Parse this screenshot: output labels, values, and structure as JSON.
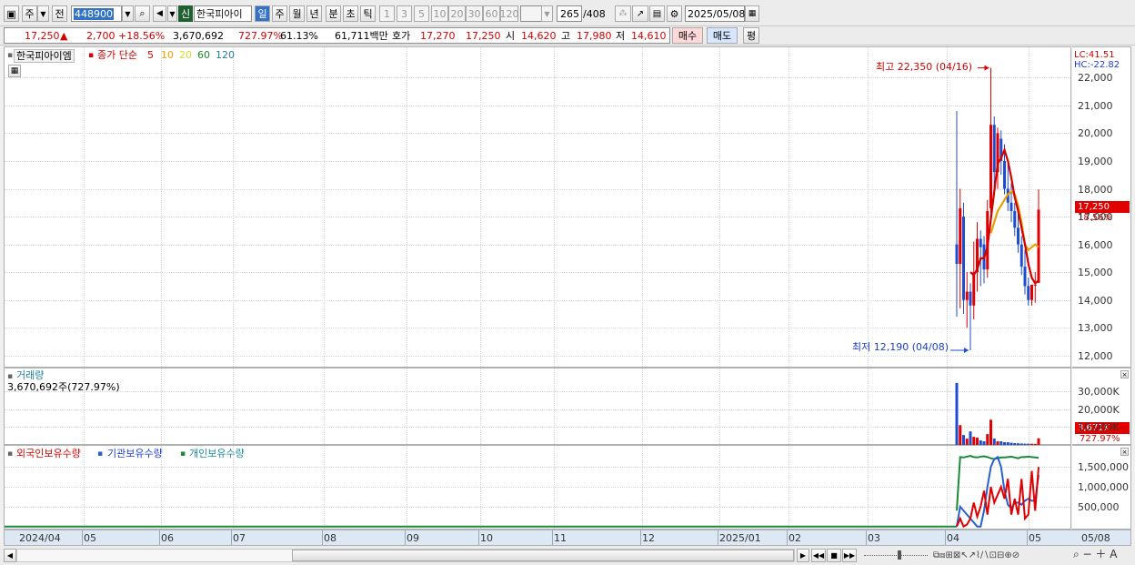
{
  "toolbar": {
    "type_label": "주",
    "prev_label": "전",
    "code": "448900",
    "new_badge": "신",
    "name": "한국피아이",
    "periods": [
      "일",
      "주",
      "월",
      "년",
      "분",
      "초",
      "틱"
    ],
    "minutes": [
      "1",
      "3",
      "5",
      "10",
      "20",
      "30",
      "60",
      "120"
    ],
    "count": "265",
    "total": "/408",
    "date": "2025/05/08"
  },
  "quote": {
    "price": "17,250",
    "change": "2,700",
    "rate": "+18.56%",
    "volume": "3,670,692",
    "vol_ratio": "727.97%",
    "turnover": "61.13%",
    "amount": "61,711백만",
    "bid_label": "호가",
    "bid": "17,270",
    "ask": "17,250",
    "open_label": "시",
    "open": "14,620",
    "high_label": "고",
    "high": "17,980",
    "low_label": "저",
    "low": "14,610",
    "buy_btn": "매수",
    "sell_btn": "매도",
    "eval_btn": "평"
  },
  "price_pane": {
    "title": "한국피아이엠",
    "ma_label": "종가 단순",
    "ma": [
      "5",
      "10",
      "20",
      "60",
      "120"
    ],
    "lc": "LC:41.51",
    "hc": "HC:-22.82",
    "max_note": "최고 22,350 (04/16)",
    "min_note": "최저 12,190 (04/08)",
    "cur_price": "17,250",
    "cur_rate": "18.56%"
  },
  "volume_pane": {
    "title": "거래량",
    "value": "3,670,692주(727.97%)",
    "cur": "3,671K",
    "cur_rate": "727.97%"
  },
  "holding_pane": {
    "series": [
      "외국인보유수량",
      "기관보유수량",
      "개인보유수량"
    ]
  },
  "x_labels": [
    "2024/04",
    "05",
    "06",
    "07",
    "08",
    "09",
    "10",
    "11",
    "12",
    "2025/01",
    "02",
    "03",
    "04",
    "05",
    "05/08"
  ],
  "colors": {
    "up": "#e00000",
    "down": "#1d4ed0",
    "ma5": "#d40000",
    "ma10": "#e8a000",
    "foreign": "#e00000",
    "inst": "#2a5fd0",
    "indiv": "#1a8a3a"
  },
  "chart_data": {
    "type": "line",
    "price_axis": {
      "ylim": [
        11700,
        22500
      ],
      "ticks": [
        "12,000",
        "13,000",
        "14,000",
        "15,000",
        "16,000",
        "17,000",
        "18,000",
        "19,000",
        "20,000",
        "21,000",
        "22,000"
      ]
    },
    "candles": [
      {
        "date": "04/02",
        "o": 16000,
        "h": 20800,
        "l": 13400,
        "c": 15300
      },
      {
        "date": "04/03",
        "o": 15300,
        "h": 18000,
        "l": 13700,
        "c": 17300
      },
      {
        "date": "04/04",
        "o": 17000,
        "h": 17500,
        "l": 13500,
        "c": 14000
      },
      {
        "date": "04/07",
        "o": 14000,
        "h": 15000,
        "l": 13000,
        "c": 14300
      },
      {
        "date": "04/08",
        "o": 14300,
        "h": 14600,
        "l": 12190,
        "c": 13800
      },
      {
        "date": "04/09",
        "o": 13800,
        "h": 16100,
        "l": 13300,
        "c": 15000
      },
      {
        "date": "04/10",
        "o": 15000,
        "h": 16800,
        "l": 14300,
        "c": 16200
      },
      {
        "date": "04/11",
        "o": 16200,
        "h": 16500,
        "l": 14500,
        "c": 15900
      },
      {
        "date": "04/14",
        "o": 16000,
        "h": 16300,
        "l": 14600,
        "c": 15100
      },
      {
        "date": "04/15",
        "o": 15100,
        "h": 17600,
        "l": 14800,
        "c": 17200
      },
      {
        "date": "04/16",
        "o": 17300,
        "h": 22350,
        "l": 16900,
        "c": 20300
      },
      {
        "date": "04/17",
        "o": 20300,
        "h": 20600,
        "l": 17800,
        "c": 18600
      },
      {
        "date": "04/18",
        "o": 18600,
        "h": 20200,
        "l": 18000,
        "c": 20000
      },
      {
        "date": "04/21",
        "o": 19800,
        "h": 20100,
        "l": 18500,
        "c": 19000
      },
      {
        "date": "04/22",
        "o": 19000,
        "h": 19600,
        "l": 17800,
        "c": 18000
      },
      {
        "date": "04/23",
        "o": 18000,
        "h": 18900,
        "l": 17200,
        "c": 17500
      },
      {
        "date": "04/24",
        "o": 17500,
        "h": 18200,
        "l": 16800,
        "c": 17200
      },
      {
        "date": "04/25",
        "o": 17200,
        "h": 17500,
        "l": 16300,
        "c": 16600
      },
      {
        "date": "04/28",
        "o": 16600,
        "h": 17100,
        "l": 15700,
        "c": 16000
      },
      {
        "date": "04/29",
        "o": 16000,
        "h": 16300,
        "l": 14900,
        "c": 15200
      },
      {
        "date": "04/30",
        "o": 15200,
        "h": 15800,
        "l": 14200,
        "c": 14500
      },
      {
        "date": "05/02",
        "o": 14500,
        "h": 14800,
        "l": 13800,
        "c": 14000
      },
      {
        "date": "05/06",
        "o": 14000,
        "h": 14400,
        "l": 13800,
        "c": 14550
      },
      {
        "date": "05/07",
        "o": 14550,
        "h": 15000,
        "l": 13900,
        "c": 14550
      },
      {
        "date": "05/08",
        "o": 14620,
        "h": 17980,
        "l": 14610,
        "c": 17250
      }
    ],
    "ma5": [
      null,
      null,
      null,
      null,
      15000,
      14900,
      15100,
      15500,
      15500,
      15900,
      16900,
      17900,
      18900,
      19100,
      19400,
      19000,
      18400,
      17700,
      17200,
      16600,
      16000,
      15300,
      14800,
      14600,
      14700
    ],
    "ma10": [
      null,
      null,
      null,
      null,
      null,
      null,
      null,
      null,
      null,
      null,
      16400,
      16800,
      17200,
      17400,
      17600,
      17800,
      17900,
      17800,
      17400,
      16800,
      16000,
      15800,
      15900,
      16000,
      15900
    ],
    "volume_axis": {
      "ylim": [
        0,
        40000
      ],
      "ticks": [
        "10,000K",
        "20,000K",
        "30,000K"
      ]
    },
    "volume_k": [
      34500,
      11000,
      5500,
      3500,
      7500,
      4500,
      4000,
      2500,
      2000,
      6000,
      14000,
      3500,
      2000,
      2000,
      1500,
      1500,
      1200,
      1000,
      900,
      800,
      700,
      700,
      650,
      600,
      3671
    ],
    "holding_axis": {
      "ylim": [
        -30000,
        1850000
      ],
      "ticks": [
        "500,000",
        "1,000,000",
        "1,500,000"
      ]
    },
    "foreign": [
      0,
      200000,
      0,
      50000,
      200000,
      600000,
      250000,
      500000,
      900000,
      300000,
      1000000,
      600000,
      800000,
      1000000,
      700000,
      1200000,
      300000,
      700000,
      300000,
      1200000,
      200000,
      300000,
      1400000,
      400000,
      1500000
    ],
    "inst": [
      0,
      500000,
      400000,
      300000,
      200000,
      100000,
      0,
      0,
      400000,
      1000000,
      1500000,
      1700000,
      1750000,
      1500000,
      900000,
      550000,
      450000,
      600000,
      600000,
      550000,
      650000,
      700000,
      650000,
      650000,
      1300000
    ],
    "indiv": [
      400000,
      1750000,
      1740000,
      1760000,
      1780000,
      1750000,
      1740000,
      1760000,
      1770000,
      1750000,
      1720000,
      1700000,
      1720000,
      1740000,
      1740000,
      1750000,
      1760000,
      1740000,
      1720000,
      1750000,
      1750000,
      1760000,
      1750000,
      1740000,
      1730000
    ]
  }
}
